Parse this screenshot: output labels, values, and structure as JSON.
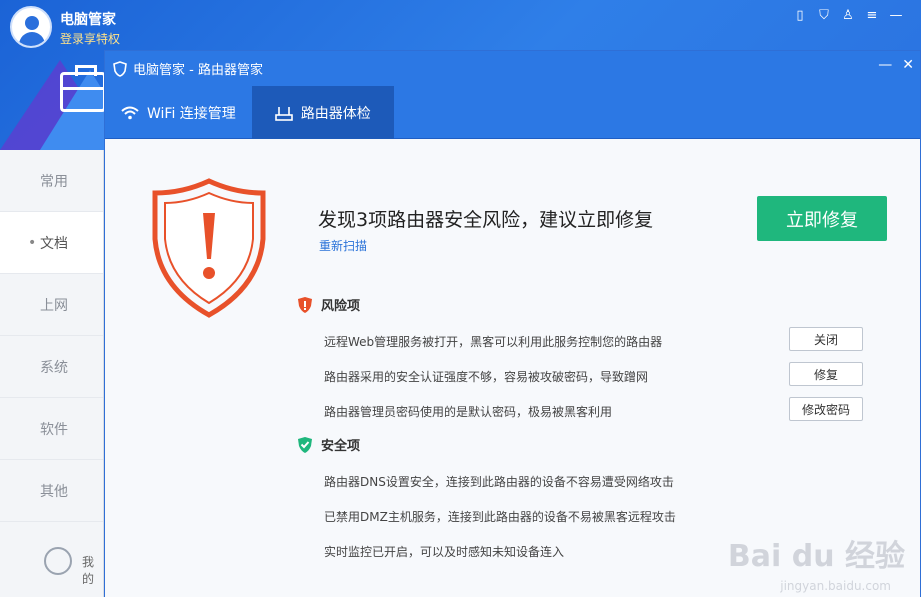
{
  "app": {
    "title": "电脑管家",
    "login": "登录享特权"
  },
  "sidebar": {
    "items": [
      {
        "label": "常用"
      },
      {
        "label": "文档"
      },
      {
        "label": "上网"
      },
      {
        "label": "系统"
      },
      {
        "label": "软件"
      },
      {
        "label": "其他"
      }
    ],
    "bottom_label": "我的"
  },
  "router_window": {
    "title": "电脑管家 - 路由器管家",
    "tabs": [
      {
        "label": "WiFi 连接管理"
      },
      {
        "label": "路由器体检"
      }
    ]
  },
  "result": {
    "headline": "发现3项路由器安全风险，建议立即修复",
    "rescan": "重新扫描",
    "fix_button": "立即修复"
  },
  "risk_section": {
    "title": "风险项",
    "items": [
      {
        "text": "远程Web管理服务被打开，黑客可以利用此服务控制您的路由器",
        "action": "关闭"
      },
      {
        "text": "路由器采用的安全认证强度不够，容易被攻破密码，导致蹭网",
        "action": "修复"
      },
      {
        "text": "路由器管理员密码使用的是默认密码，极易被黑客利用",
        "action": "修改密码"
      }
    ]
  },
  "safe_section": {
    "title": "安全项",
    "items": [
      {
        "text": "路由器DNS设置安全，连接到此路由器的设备不容易遭受网络攻击"
      },
      {
        "text": "已禁用DMZ主机服务，连接到此路由器的设备不易被黑客远程攻击"
      },
      {
        "text": "实时监控已开启，可以及时感知未知设备连入"
      }
    ]
  },
  "watermark": {
    "main": "Bai du 经验",
    "sub": "jingyan.baidu.com"
  },
  "colors": {
    "brand_blue": "#2c78e4",
    "fix_green": "#1fb77d",
    "risk_orange": "#e8512a",
    "safe_green": "#1fb77d"
  }
}
